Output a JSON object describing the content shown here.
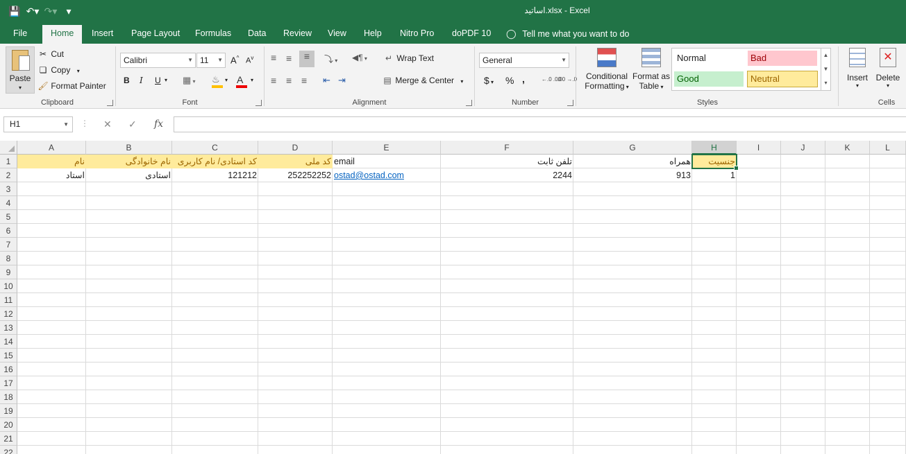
{
  "window": {
    "title": "اساتید.xlsx  -  Excel"
  },
  "tabs": [
    "File",
    "Home",
    "Insert",
    "Page Layout",
    "Formulas",
    "Data",
    "Review",
    "View",
    "Help",
    "Nitro Pro",
    "doPDF 10"
  ],
  "tell_me": "Tell me what you want to do",
  "clipboard": {
    "paste": "Paste",
    "cut": "Cut",
    "copy": "Copy",
    "format_painter": "Format Painter",
    "label": "Clipboard"
  },
  "font": {
    "name": "Calibri",
    "size": "11",
    "label": "Font",
    "bold": "B",
    "italic": "I",
    "underline": "U"
  },
  "alignment": {
    "wrap_text": "Wrap Text",
    "merge_center": "Merge & Center",
    "label": "Alignment"
  },
  "number": {
    "format": "General",
    "label": "Number",
    "currency": "$",
    "percent": "%",
    "comma": ",",
    "inc_decimal": "←.0 .00",
    "dec_decimal": ".00 →.0"
  },
  "styles": {
    "conditional": [
      "Conditional",
      "Formatting"
    ],
    "format_table": [
      "Format as",
      "Table"
    ],
    "normal": "Normal",
    "bad": "Bad",
    "good": "Good",
    "neutral": "Neutral",
    "label": "Styles",
    "colors": {
      "bad_bg": "#ffc7ce",
      "bad_fg": "#9c0006",
      "good_bg": "#c6efce",
      "good_fg": "#006100",
      "neutral_bg": "#ffeb9c",
      "neutral_fg": "#9c6500"
    }
  },
  "cells": {
    "insert": "Insert",
    "delete": "Delete",
    "label": "Cells"
  },
  "formula_bar": {
    "name_box": "H1",
    "value": ""
  },
  "sheet": {
    "columns": [
      "A",
      "B",
      "C",
      "D",
      "E",
      "F",
      "G",
      "H",
      "I",
      "J",
      "K",
      "L"
    ],
    "selected_column": "H",
    "rows": [
      "1",
      "2",
      "3",
      "4",
      "5",
      "6",
      "7",
      "8",
      "9",
      "10",
      "11",
      "12",
      "13",
      "14",
      "15",
      "16",
      "17",
      "18",
      "19",
      "20",
      "21",
      "22"
    ],
    "row1": {
      "A": "نام",
      "B": "نام خانوادگی",
      "C": "کد استادی/ نام کاربری",
      "D": "کد ملی",
      "E": "email",
      "F": "تلفن ثابت",
      "G": "همراه",
      "H": "جنسیت"
    },
    "row2": {
      "A": "استاد",
      "B": "استادی",
      "C": "121212",
      "D": "252252252",
      "E": "ostad@ostad.com",
      "F": "2244",
      "G": "913",
      "H": "1"
    }
  }
}
